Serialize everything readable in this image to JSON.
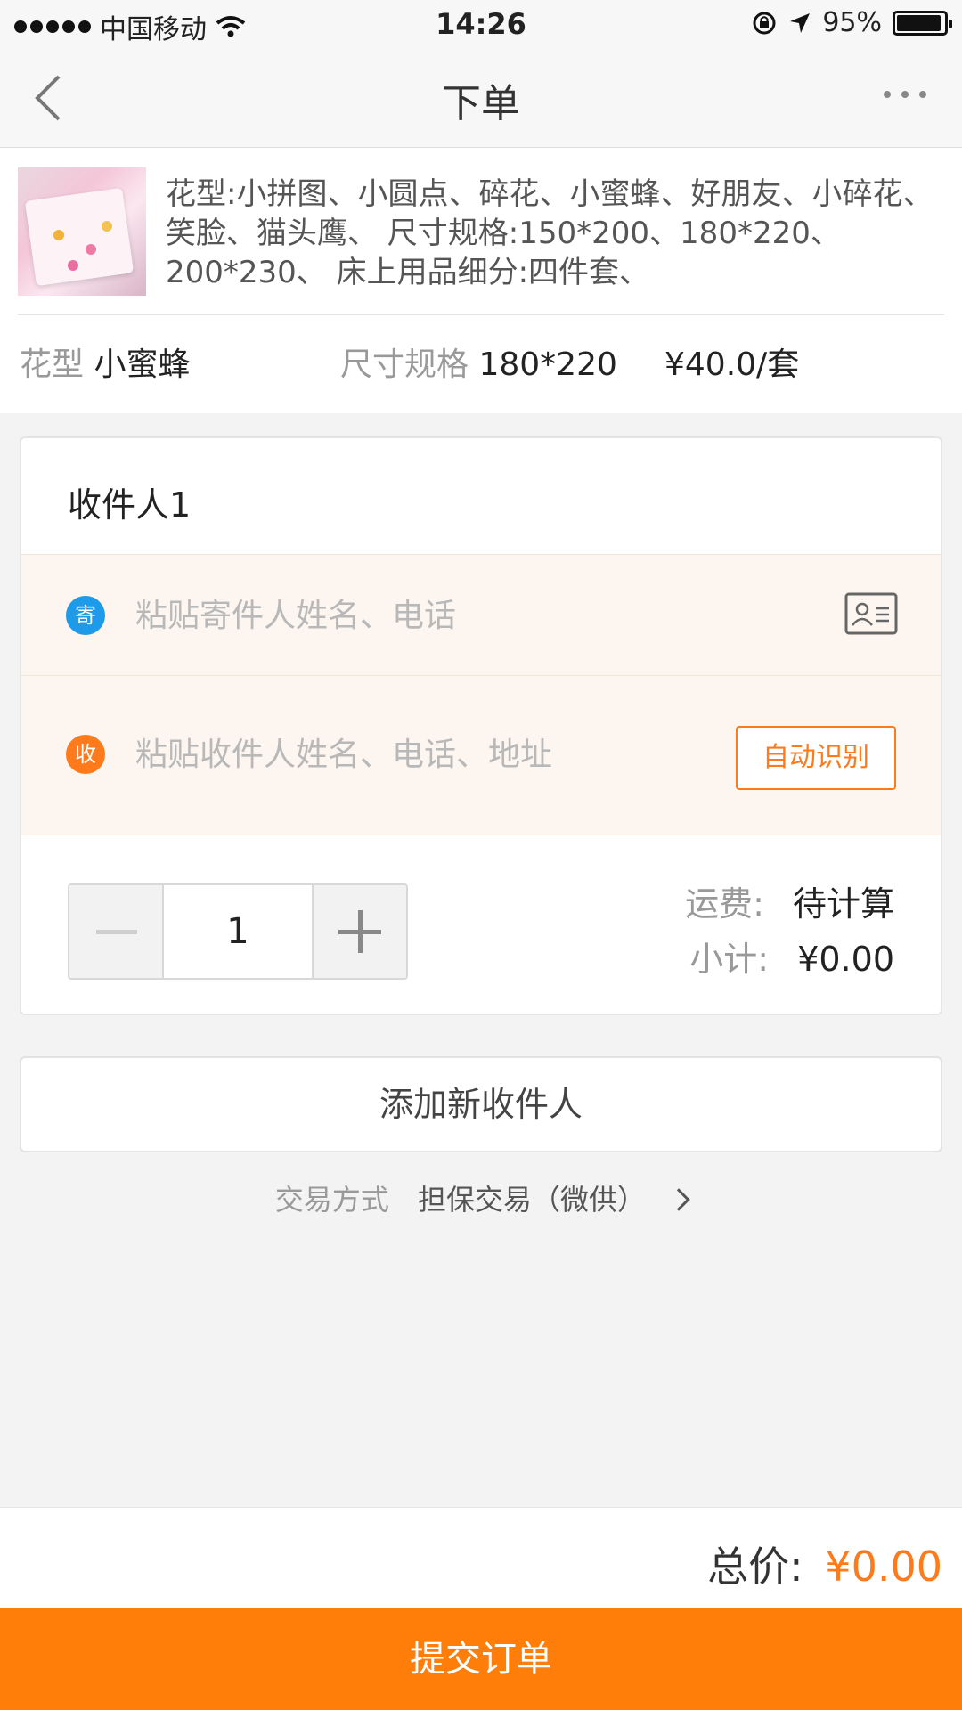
{
  "status_bar": {
    "carrier": "中国移动",
    "time": "14:26",
    "battery": "95%",
    "battery_level": 0.95,
    "icons": [
      "signal-dots-icon",
      "wifi-icon",
      "rotation-lock-icon",
      "location-arrow-icon",
      "battery-icon"
    ]
  },
  "nav": {
    "title": "下单",
    "back_icon": "chevron-left-icon",
    "more_icon": "more-dots-icon"
  },
  "product": {
    "description": "花型:小拼图、小圆点、碎花、小蜜蜂、好朋友、小碎花、笑脸、猫头鹰、 尺寸规格:150*200、180*220、200*230、 床上用品细分:四件套、",
    "pattern_label": "花型",
    "pattern_value": "小蜜蜂",
    "size_label": "尺寸规格",
    "size_value": "180*220",
    "price": "¥40.0/套"
  },
  "recipient": {
    "title": "收件人1",
    "sender_badge": "寄",
    "sender_placeholder": "粘贴寄件人姓名、电话",
    "receiver_badge": "收",
    "receiver_placeholder": "粘贴收件人姓名、电话、地址",
    "auto_recognize_label": "自动识别",
    "quantity": "1",
    "shipping_label": "运费:",
    "shipping_value": "待计算",
    "subtotal_label": "小计:",
    "subtotal_value": "¥0.00"
  },
  "add_recipient_label": "添加新收件人",
  "trade": {
    "label": "交易方式",
    "value": "担保交易（微供）"
  },
  "footer": {
    "total_label": "总价:",
    "total_value": "¥0.00",
    "submit_label": "提交订单"
  },
  "colors": {
    "accent": "#ff7e0a",
    "sender_badge": "#1e9be8",
    "receiver_badge": "#ff7a1a",
    "paste_area_bg": "#fdf5ef"
  }
}
